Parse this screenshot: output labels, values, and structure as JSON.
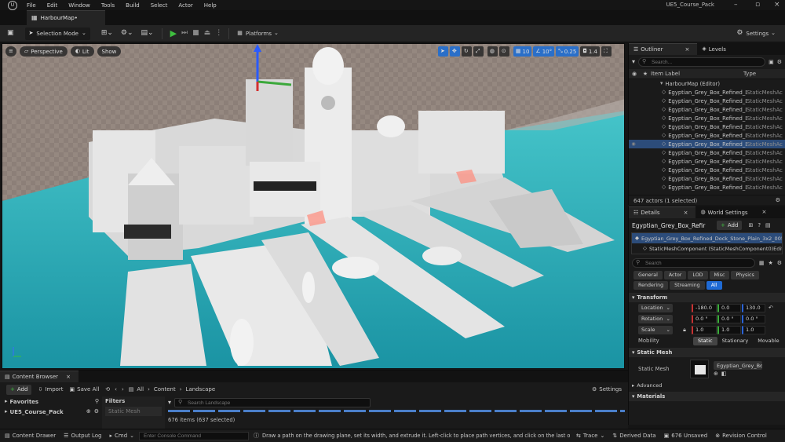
{
  "menu": {
    "items": [
      "File",
      "Edit",
      "Window",
      "Tools",
      "Build",
      "Select",
      "Actor",
      "Help"
    ],
    "project_name": "UE5_Course_Pack"
  },
  "tab": {
    "map_name": "HarbourMap•"
  },
  "toolbar": {
    "selection_mode": "Selection Mode",
    "platforms": "Platforms",
    "settings": "Settings"
  },
  "viewport": {
    "perspective": "Perspective",
    "lit": "Lit",
    "show": "Show",
    "grid_snap": "10",
    "rot_snap": "10°",
    "scale_snap": "0.25",
    "cam_speed": "1.4"
  },
  "outliner": {
    "tab_outliner": "Outliner",
    "tab_levels": "Levels",
    "search_placeholder": "Search...",
    "col_label": "Item Label",
    "col_type": "Type",
    "root": "HarbourMap (Editor)",
    "rows": [
      {
        "name": "Egyptian_Grey_Box_Refined_D",
        "type": "StaticMeshAc",
        "selected": false
      },
      {
        "name": "Egyptian_Grey_Box_Refined_D",
        "type": "StaticMeshAc",
        "selected": false
      },
      {
        "name": "Egyptian_Grey_Box_Refined_D",
        "type": "StaticMeshAc",
        "selected": false
      },
      {
        "name": "Egyptian_Grey_Box_Refined_D",
        "type": "StaticMeshAc",
        "selected": false
      },
      {
        "name": "Egyptian_Grey_Box_Refined_D",
        "type": "StaticMeshAc",
        "selected": false
      },
      {
        "name": "Egyptian_Grey_Box_Refined_D",
        "type": "StaticMeshAc",
        "selected": false
      },
      {
        "name": "Egyptian_Grey_Box_Refined_D",
        "type": "StaticMeshAc",
        "selected": true
      },
      {
        "name": "Egyptian_Grey_Box_Refined_D",
        "type": "StaticMeshAc",
        "selected": false
      },
      {
        "name": "Egyptian_Grey_Box_Refined_D",
        "type": "StaticMeshAc",
        "selected": false
      },
      {
        "name": "Egyptian_Grey_Box_Refined_D",
        "type": "StaticMeshAc",
        "selected": false
      },
      {
        "name": "Egyptian_Grey_Box_Refined_D",
        "type": "StaticMeshAc",
        "selected": false
      },
      {
        "name": "Egyptian_Grey_Box_Refined_D",
        "type": "StaticMeshAc",
        "selected": false
      }
    ],
    "count": "647 actors (1 selected)"
  },
  "details": {
    "tab_details": "Details",
    "tab_world": "World Settings",
    "actor_name": "Egyptian_Grey_Box_Refir",
    "add": "Add",
    "component_root": "Egyptian_Grey_Box_Refined_Dock_Stone_Plain_3x2_005 (",
    "component_child": "StaticMeshComponent (StaticMeshComponent0)",
    "edit": "Edit",
    "search_placeholder": "Search",
    "filters_row1": [
      "General",
      "Actor",
      "LOD",
      "Misc",
      "Physics"
    ],
    "filters_row2": [
      "Rendering",
      "Streaming",
      "All"
    ],
    "transform_header": "Transform",
    "location": {
      "label": "Location",
      "x": "-180.0",
      "y": "0.0",
      "z": "130.0"
    },
    "rotation": {
      "label": "Rotation",
      "x": "0.0 °",
      "y": "0.0 °",
      "z": "0.0 °"
    },
    "scale": {
      "label": "Scale",
      "x": "1.0",
      "y": "1.0",
      "z": "1.0"
    },
    "mobility_label": "Mobility",
    "mobility": [
      "Static",
      "Stationary",
      "Movable"
    ],
    "static_mesh_header": "Static Mesh",
    "static_mesh_label": "Static Mesh",
    "static_mesh_value": "Egyptian_Grey_Bo",
    "advanced": "Advanced",
    "materials_header": "Materials"
  },
  "content_browser": {
    "tab": "Content Browser",
    "add": "Add",
    "import": "Import",
    "save_all": "Save All",
    "crumbs": [
      "All",
      "Content",
      "Landscape"
    ],
    "settings": "Settings",
    "favorites": "Favorites",
    "project": "UE5_Course_Pack",
    "filters": "Filters",
    "filter_chip": "Static Mesh",
    "search_placeholder": "Search Landscape",
    "count": "676 items (637 selected)"
  },
  "status": {
    "content_drawer": "Content Drawer",
    "output_log": "Output Log",
    "cmd": "Cmd",
    "console_placeholder": "Enter Console Command",
    "hint": "Draw a path on the drawing plane, set its width, and extrude it. Left-click to place path vertices, and click on the last or first vertex to",
    "trace": "Trace",
    "derived": "Derived Data",
    "unsaved": "676 Unsaved",
    "revision": "Revision Control"
  },
  "colors": {
    "accent": "#1f6ad4",
    "selection": "#2c4c7a",
    "water": "#2fb8c2",
    "play": "#3fbf3f"
  }
}
